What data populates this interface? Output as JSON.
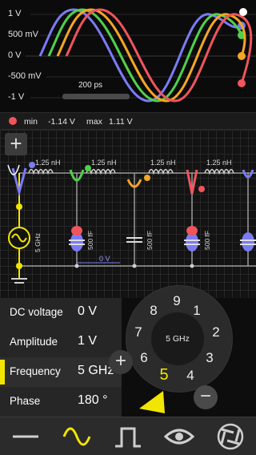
{
  "scope": {
    "y_labels": [
      "1 V",
      "500 mV",
      "0 V",
      "-500 mV",
      "-1 V"
    ],
    "time_scale": "200 ps",
    "traces": [
      {
        "name": "",
        "color": "#7b7bf5"
      },
      {
        "name": "",
        "color": "#4fd14a"
      },
      {
        "name": "",
        "color": "#f5a623"
      },
      {
        "name": "",
        "color": "#f0545c"
      }
    ]
  },
  "status": {
    "probe_color": "#f0545c",
    "min_label": "min",
    "min_value": "-1.14 V",
    "max_label": "max",
    "max_value": "1.11 V"
  },
  "circuit": {
    "add_label": "+",
    "inductor_labels": [
      "1.25 nH",
      "1.25 nH",
      "1.25 nH",
      "1.25 nH"
    ],
    "capacitor_labels": [
      "500 fF",
      "500 fF",
      "500 fF"
    ],
    "source_label": "5 GHz",
    "node_voltage": "0 V"
  },
  "parameters": [
    {
      "label": "DC voltage",
      "value": "0 V",
      "selected": false
    },
    {
      "label": "Amplitude",
      "value": "1 V",
      "selected": false
    },
    {
      "label": "Frequency",
      "value": "5 GHz",
      "selected": true
    },
    {
      "label": "Phase",
      "value": "180 °",
      "selected": false
    }
  ],
  "dial": {
    "center_label": "5 GHz",
    "digits": [
      "9",
      "1",
      "2",
      "3",
      "4",
      "5",
      "6",
      "7",
      "8"
    ],
    "selected_digit": "5",
    "plus_label": "+",
    "minus_label": "−"
  },
  "toolbar": {
    "items": [
      "dc-source",
      "ac-source",
      "pulse-source",
      "probe-view",
      "transform"
    ],
    "accent": "#f2e600"
  }
}
